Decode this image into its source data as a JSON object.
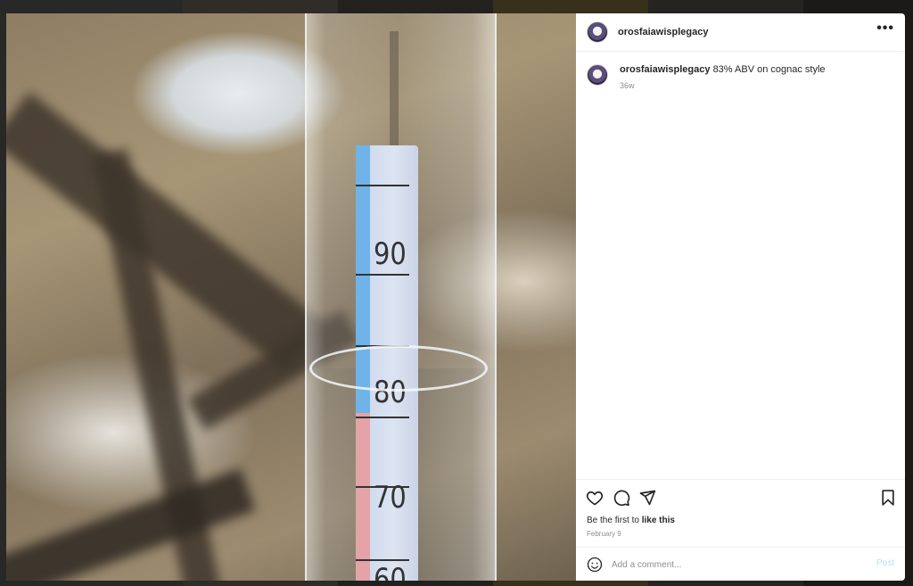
{
  "post": {
    "username": "orosfaiawisplegacy",
    "caption_username": "orosfaiawisplegacy",
    "caption_text": "83% ABV on cognac style",
    "age": "36w",
    "likes_prefix": "Be the first to ",
    "likes_link": "like this",
    "date": "February 9"
  },
  "photo": {
    "scale_labels": [
      "90",
      "80",
      "70",
      "60"
    ]
  },
  "comment": {
    "placeholder": "Add a comment...",
    "post_label": "Post"
  },
  "icons": {
    "more": "more-options-icon",
    "like": "heart-icon",
    "comment": "comment-icon",
    "share": "share-icon",
    "save": "bookmark-icon",
    "emoji": "emoji-icon"
  },
  "colors": {
    "post_button": "#b2dffc",
    "secondary_text": "#8e8e8e"
  }
}
